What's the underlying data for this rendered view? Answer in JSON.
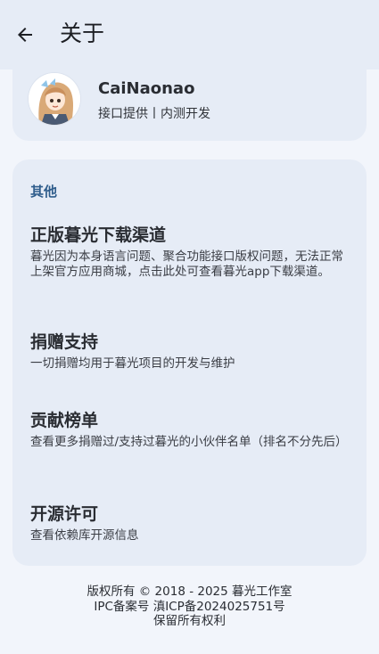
{
  "header": {
    "title": "关于",
    "back_icon": "arrow-left-icon"
  },
  "profile": {
    "name": "CaiNaonao",
    "subtitle": "接口提供丨内测开发",
    "avatar_icon": "anime-girl-avatar"
  },
  "section": {
    "title": "其他",
    "items": [
      {
        "title": "正版暮光下载渠道",
        "desc": "暮光因为本身语言问题、聚合功能接口版权问题，无法正常上架官方应用商城，点击此处可查看暮光app下载渠道。"
      },
      {
        "title": "捐赠支持",
        "desc": "一切捐赠均用于暮光项目的开发与维护"
      },
      {
        "title": "贡献榜单",
        "desc": "查看更多捐赠过/支持过暮光的小伙伴名单（排名不分先后）"
      },
      {
        "title": "开源许可",
        "desc": "查看依赖库开源信息"
      }
    ]
  },
  "footer": {
    "line1": "版权所有 © 2018 - 2025 暮光工作室",
    "line2": "IPC备案号 滇ICP备2024025751号",
    "line3": "保留所有权利"
  },
  "colors": {
    "background": "#f2f5fb",
    "card": "#e6ecf6",
    "accent": "#2f5d8c"
  }
}
